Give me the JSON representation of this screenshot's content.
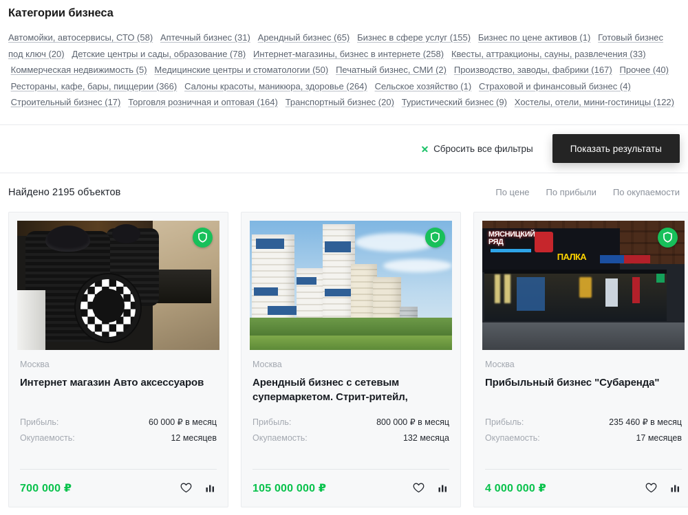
{
  "header": {
    "title": "Категории бизнеса"
  },
  "categories": [
    {
      "label": "Автомойки, автосервисы, СТО (58)"
    },
    {
      "label": "Аптечный бизнес (31)"
    },
    {
      "label": "Арендный бизнес (65)"
    },
    {
      "label": "Бизнес в сфере услуг (155)"
    },
    {
      "label": "Бизнес по цене активов (1)"
    },
    {
      "label": "Готовый бизнес под ключ (20)"
    },
    {
      "label": "Детские центры и сады, образование (78)"
    },
    {
      "label": "Интернет-магазины, бизнес в интернете (258)"
    },
    {
      "label": "Квесты, аттракционы, сауны, развлечения (33)"
    },
    {
      "label": "Коммерческая недвижимость (5)"
    },
    {
      "label": "Медицинские центры и стоматологии (50)"
    },
    {
      "label": "Печатный бизнес, СМИ (2)"
    },
    {
      "label": "Производство, заводы, фабрики (167)"
    },
    {
      "label": "Прочее (40)"
    },
    {
      "label": "Рестораны, кафе, бары, пиццерии (366)"
    },
    {
      "label": "Салоны красоты, маникюра, здоровье (264)"
    },
    {
      "label": "Сельское хозяйство (1)"
    },
    {
      "label": "Страховой и финансовый бизнес (4)"
    },
    {
      "label": "Строительный бизнес (17)"
    },
    {
      "label": "Торговля розничная и оптовая (164)"
    },
    {
      "label": "Транспортный бизнес (20)"
    },
    {
      "label": "Туристический бизнес (9)"
    },
    {
      "label": "Хостелы, отели, мини-гостиницы (122)"
    }
  ],
  "filters": {
    "reset_label": "Сбросить все фильтры",
    "reset_icon": "close-x-icon",
    "submit_label": "Показать результаты"
  },
  "results": {
    "found_label": "Найдено 2195 объектов",
    "sorts": [
      {
        "label": "По цене"
      },
      {
        "label": "По прибыли"
      },
      {
        "label": "По окупаемости"
      }
    ]
  },
  "labels": {
    "profit": "Прибыль:",
    "payback": "Окупаемость:",
    "verified_icon": "shield-icon",
    "favorite_icon": "heart-icon",
    "compare_icon": "bar-chart-icon"
  },
  "cards": [
    {
      "city": "Москва",
      "title": "Интернет магазин Авто аксессуаров",
      "profit": "60 000 ₽ в месяц",
      "payback": "12 месяцев",
      "price": "700 000 ₽",
      "photo": "car-interior-seat-covers"
    },
    {
      "city": "Москва",
      "title": "Арендный бизнес с сетевым супермаркетом. Стрит-ритейл,",
      "profit": "800 000 ₽ в месяц",
      "payback": "132 месяца",
      "price": "105 000 000 ₽",
      "photo": "residential-highrise-buildings"
    },
    {
      "city": "Москва",
      "title": "Прибыльный бизнес \"Субаренда\"",
      "profit": "235 460 ₽ в месяц",
      "payback": "17 месяцев",
      "price": "4 000 000 ₽",
      "photo": "street-retail-storefront"
    }
  ],
  "colors": {
    "accent_green": "#09c24c",
    "badge_green": "#18c05a",
    "button_dark": "#242424",
    "muted_text": "#a3a8b0",
    "link_text": "#5c6470"
  }
}
